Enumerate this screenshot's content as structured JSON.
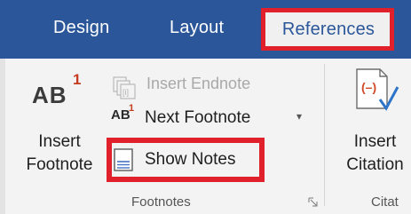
{
  "tabs": [
    "Design",
    "Layout",
    "References"
  ],
  "footnotes_group": {
    "insert_footnote": {
      "icon_text": "AB",
      "icon_sup": "1",
      "label_line1": "Insert",
      "label_line2": "Footnote"
    },
    "insert_endnote": {
      "label": "Insert Endnote"
    },
    "next_footnote": {
      "icon_text": "AB",
      "icon_sup": "1",
      "label": "Next Footnote"
    },
    "show_notes": {
      "label": "Show Notes"
    },
    "group_label": "Footnotes"
  },
  "citations_group": {
    "insert_citation": {
      "label_line1": "Insert",
      "label_line2": "Citation"
    },
    "group_label": "Citat"
  },
  "colors": {
    "tab_bar": "#2b579a",
    "highlight": "#e0202a",
    "superscript": "#c43b1d"
  }
}
